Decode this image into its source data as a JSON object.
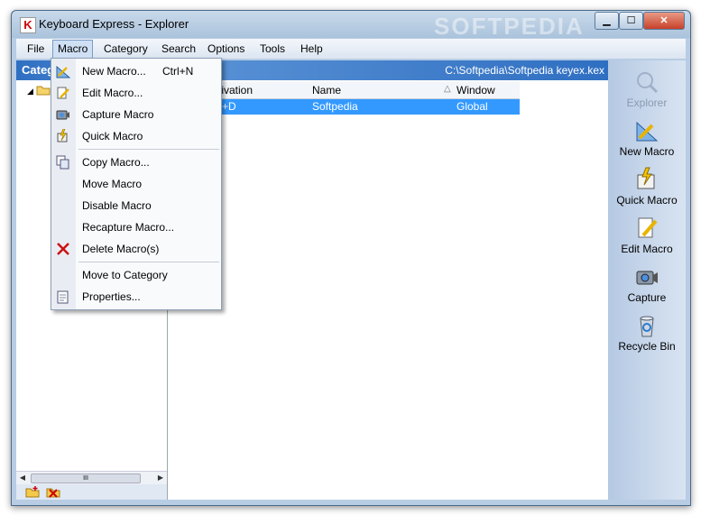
{
  "window": {
    "title": "Keyboard Express - Explorer",
    "app_icon": "K",
    "watermark": "SOFTPEDIA"
  },
  "menubar": {
    "items": [
      {
        "label": "File"
      },
      {
        "label": "Macro",
        "open": true
      },
      {
        "label": "Category"
      },
      {
        "label": "Search"
      },
      {
        "label": "Options"
      },
      {
        "label": "Tools"
      },
      {
        "label": "Help"
      }
    ]
  },
  "category_panel": {
    "header": "Categ",
    "scroll_grip": "III"
  },
  "main": {
    "path": "C:\\Softpedia\\Softpedia keyex.kex",
    "columns": [
      "ctivation",
      "Name",
      "Window"
    ],
    "rows": [
      {
        "activation": "trl+D",
        "name": "Softpedia",
        "window": "Global"
      }
    ]
  },
  "sidebar": {
    "buttons": [
      {
        "label": "Explorer",
        "icon": "explorer-icon",
        "enabled": false
      },
      {
        "label": "New Macro",
        "icon": "new-macro-icon",
        "enabled": true
      },
      {
        "label": "Quick Macro",
        "icon": "quick-macro-icon",
        "enabled": true
      },
      {
        "label": "Edit Macro",
        "icon": "edit-macro-icon",
        "enabled": true
      },
      {
        "label": "Capture",
        "icon": "capture-icon",
        "enabled": true
      },
      {
        "label": "Recycle Bin",
        "icon": "recycle-bin-icon",
        "enabled": true
      }
    ]
  },
  "macro_menu": {
    "items": [
      {
        "label": "New Macro...",
        "shortcut": "Ctrl+N",
        "icon": "new-macro-icon"
      },
      {
        "label": "Edit Macro...",
        "icon": "edit-macro-icon"
      },
      {
        "label": "Capture Macro",
        "icon": "capture-icon"
      },
      {
        "label": "Quick Macro",
        "icon": "quick-macro-icon"
      },
      {
        "label": "Copy Macro...",
        "icon": "copy-icon"
      },
      {
        "label": "Move Macro"
      },
      {
        "label": "Disable Macro"
      },
      {
        "label": "Recapture Macro..."
      },
      {
        "label": "Delete Macro(s)",
        "icon": "delete-icon"
      },
      {
        "label": "Move to Category"
      },
      {
        "label": "Properties...",
        "icon": "properties-icon"
      }
    ]
  },
  "colors": {
    "selection": "#3399ff",
    "header_blue": "#2f6fc2",
    "delete_red": "#cc1111"
  }
}
